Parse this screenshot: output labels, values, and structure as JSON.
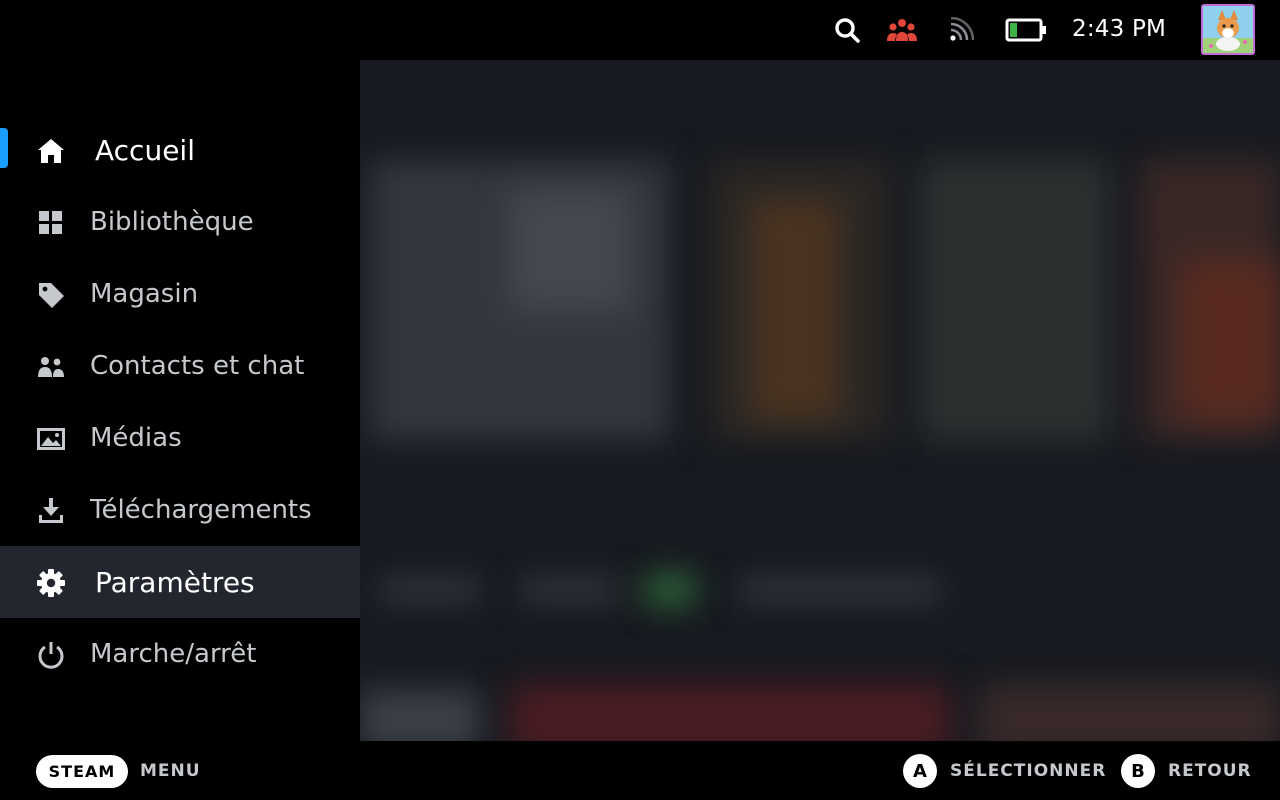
{
  "status_bar": {
    "time": "2:43 PM",
    "icons": [
      "search-icon",
      "friends-icon",
      "wifi-icon",
      "battery-icon"
    ],
    "friends_icon_color": "#e0463a",
    "battery_level": 0.25,
    "battery_fill_color": "#3db349"
  },
  "menu": {
    "items": [
      {
        "label": "Accueil",
        "icon": "home-icon"
      },
      {
        "label": "Bibliothèque",
        "icon": "library-icon"
      },
      {
        "label": "Magasin",
        "icon": "store-tag-icon"
      },
      {
        "label": "Contacts et chat",
        "icon": "friends-icon"
      },
      {
        "label": "Médias",
        "icon": "media-icon"
      },
      {
        "label": "Téléchargements",
        "icon": "download-icon"
      },
      {
        "label": "Paramètres",
        "icon": "gear-icon"
      },
      {
        "label": "Marche/arrêt",
        "icon": "power-icon"
      }
    ],
    "focused_item": "Paramètres",
    "active_item": "Accueil",
    "accent_color": "#1a9fff"
  },
  "bottom_bar": {
    "steam_label": "STEAM",
    "menu_label": "MENU",
    "a_key": "A",
    "a_label": "SÉLECTIONNER",
    "b_key": "B",
    "b_label": "RETOUR"
  }
}
